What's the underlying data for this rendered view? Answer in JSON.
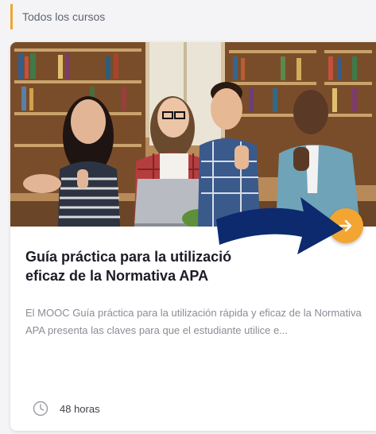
{
  "breadcrumb": {
    "label": "Todos los cursos"
  },
  "course_card": {
    "title": "Guía práctica para la utilización rápida y eficaz de la Normativa APA",
    "title_visible_line1": "Guía práctica para la utilizació",
    "title_visible_line2": "eficaz de la Normativa APA",
    "description": "El MOOC Guía práctica para la utilización rápida y eficaz de la Normativa APA presenta las claves para que el estudiante utilice e...",
    "duration": "48 horas",
    "image_icon": "students-thumbs-up-photo",
    "action_icon": "arrow-right-icon",
    "duration_icon": "clock-icon"
  },
  "annotation": {
    "icon": "big-arrow-pointer-icon"
  },
  "colors": {
    "accent": "#f2a531",
    "title": "#1c1c27",
    "description": "#8a8d96",
    "annotation_arrow": "#0d2a6e"
  }
}
